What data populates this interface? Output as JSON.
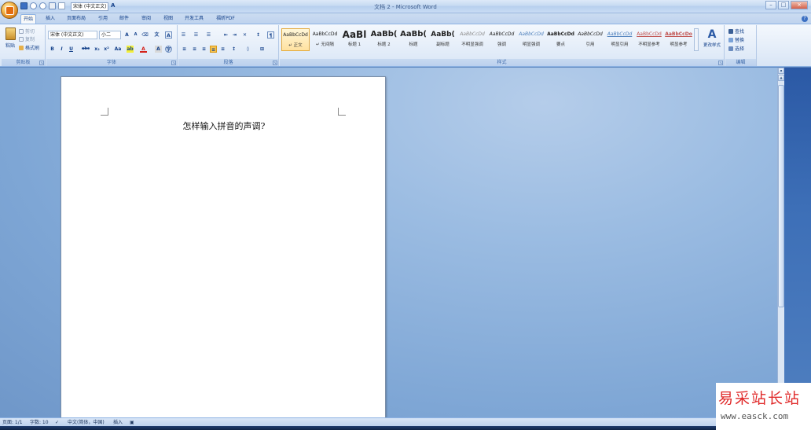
{
  "window": {
    "title": "文档 2 - Microsoft Word",
    "font_mini": "宋体 (中文正文)"
  },
  "tabs": [
    "开始",
    "插入",
    "页面布局",
    "引用",
    "邮件",
    "审阅",
    "视图",
    "开发工具",
    "福昕PDF"
  ],
  "ribbon": {
    "clipboard": {
      "label": "剪贴板",
      "paste": "粘贴",
      "cut": "剪切",
      "copy": "复制",
      "format_painter": "格式刷"
    },
    "font": {
      "label": "字体",
      "font_name": "宋体 (中文正文)",
      "font_size": "小二"
    },
    "paragraph": {
      "label": "段落"
    },
    "styles": {
      "label": "样式",
      "items": [
        {
          "sample": "AaBbCcDd",
          "name": "↵ 正文"
        },
        {
          "sample": "AaBbCcDd",
          "name": "↵ 无间隔"
        },
        {
          "sample": "AaBl",
          "name": "标题 1"
        },
        {
          "sample": "AaBb(",
          "name": "标题 2"
        },
        {
          "sample": "AaBb(",
          "name": "标题"
        },
        {
          "sample": "AaBb(",
          "name": "副标题"
        },
        {
          "sample": "AaBbCcDd",
          "name": "不明显强调"
        },
        {
          "sample": "AaBbCcDd",
          "name": "强调"
        },
        {
          "sample": "AaBbCcDd",
          "name": "明显强调"
        },
        {
          "sample": "AaBbCcDd",
          "name": "要点"
        },
        {
          "sample": "AaBbCcDd",
          "name": "引用"
        },
        {
          "sample": "AaBbCcDd",
          "name": "明显引用"
        },
        {
          "sample": "AaBbCcDd",
          "name": "不明显参考"
        },
        {
          "sample": "AaBbCcDo",
          "name": "明显参考"
        }
      ],
      "change_styles": "更改样式"
    },
    "editing": {
      "label": "编辑",
      "find": "查找",
      "replace": "替换",
      "select": "选择"
    }
  },
  "document": {
    "text": "怎样输入拼音的声调?"
  },
  "status": {
    "page": "页面: 1/1",
    "words": "字数: 10",
    "language": "中文(简体，中国)",
    "mode": "插入"
  },
  "watermark": {
    "cn": "易采站长站",
    "url": "www.easck.com"
  },
  "colors": {
    "ribbon_bg": "#e4edf9",
    "doc_bg": "#7ea6d5",
    "accent": "#15428b",
    "watermark_red": "#e02a2a"
  }
}
